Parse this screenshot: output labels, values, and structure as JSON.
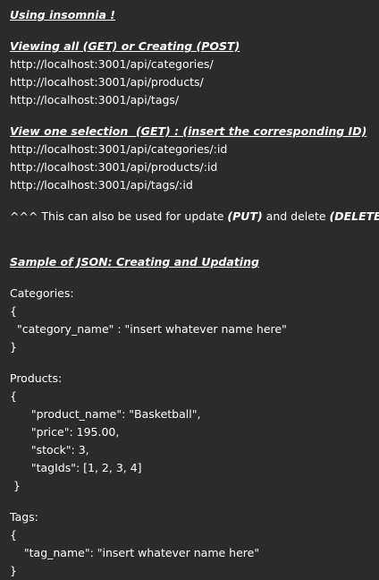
{
  "title": "Using insomnia !",
  "view_all": {
    "heading": "Viewing all (GET) or Creating (POST)",
    "urls": [
      "http://localhost:3001/api/categories/",
      "http://localhost:3001/api/products/",
      "http://localhost:3001/api/tags/"
    ]
  },
  "view_one": {
    "heading": "View one selection  (GET) : (insert the corresponding ID)",
    "urls": [
      "http://localhost:3001/api/categories/:id",
      "http://localhost:3001/api/products/:id",
      "http://localhost:3001/api/tags/:id"
    ]
  },
  "note": {
    "prefix": "^^^ This can also be used for update ",
    "put": "(PUT)",
    "middle": " and delete ",
    "delete": "(DELETE)"
  },
  "sample": {
    "heading": "Sample of JSON: Creating and Updating",
    "categories": {
      "label": "Categories:",
      "lines": [
        "{",
        "  \"category_name\" : \"insert whatever name here\"",
        "}"
      ]
    },
    "products": {
      "label": "Products:",
      "lines": [
        "{",
        "      \"product_name\": \"Basketball\",",
        "      \"price\": 195.00,",
        "      \"stock\": 3,",
        "      \"tagIds\": [1, 2, 3, 4]",
        " }"
      ]
    },
    "tags": {
      "label": "Tags:",
      "lines": [
        "{",
        "    \"tag_name\": \"insert whatever name here\"",
        "}"
      ]
    }
  }
}
